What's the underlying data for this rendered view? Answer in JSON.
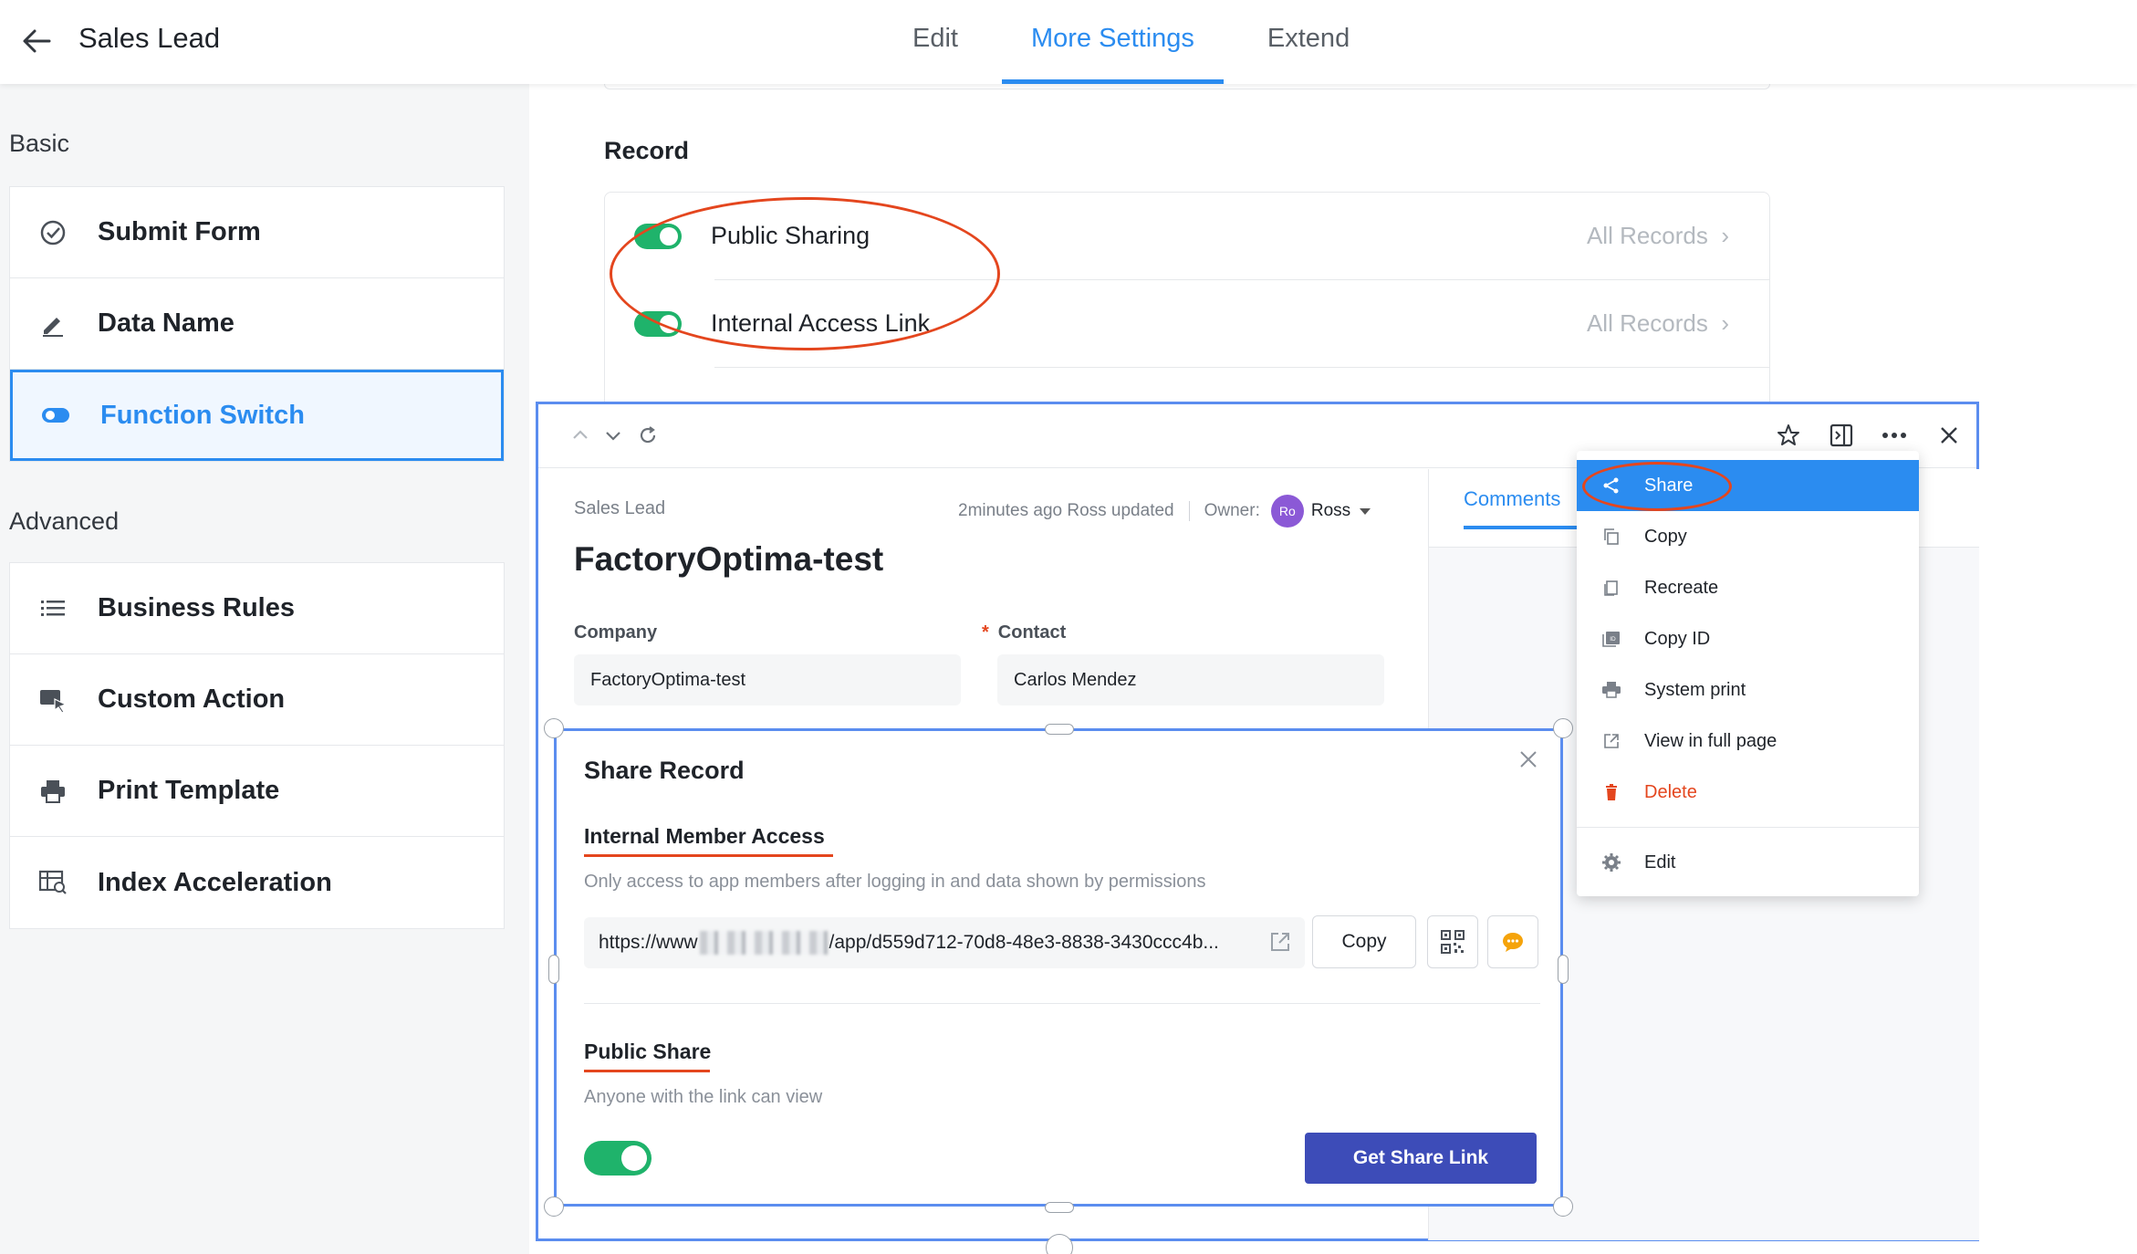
{
  "header": {
    "title": "Sales Lead",
    "tabs": [
      {
        "label": "Edit"
      },
      {
        "label": "More Settings",
        "active": true
      },
      {
        "label": "Extend"
      }
    ]
  },
  "sidebar": {
    "basic_label": "Basic",
    "basic_items": [
      {
        "label": "Submit Form",
        "icon": "check-circle-icon"
      },
      {
        "label": "Data Name",
        "icon": "pencil-icon"
      },
      {
        "label": "Function Switch",
        "icon": "toggle-icon",
        "selected": true
      }
    ],
    "advanced_label": "Advanced",
    "advanced_items": [
      {
        "label": "Business Rules",
        "icon": "list-icon"
      },
      {
        "label": "Custom Action",
        "icon": "cursor-card-icon"
      },
      {
        "label": "Print Template",
        "icon": "printer-icon"
      },
      {
        "label": "Index Acceleration",
        "icon": "table-search-icon"
      }
    ]
  },
  "record_section": {
    "title": "Record",
    "rows": [
      {
        "label": "Public Sharing",
        "link": "All Records",
        "enabled": true
      },
      {
        "label": "Internal Access Link",
        "link": "All Records",
        "enabled": true
      }
    ]
  },
  "detail": {
    "breadcrumb": "Sales Lead",
    "updated": "2minutes ago Ross updated",
    "owner_label": "Owner:",
    "owner_initials": "Ro",
    "owner_name": "Ross",
    "record_name": "FactoryOptima-test",
    "fields": [
      {
        "label": "Company",
        "value": "FactoryOptima-test",
        "required": false
      },
      {
        "label": "Contact",
        "value": "Carlos Mendez",
        "required": true
      }
    ],
    "right_tab": "Comments"
  },
  "more_menu": {
    "items": [
      {
        "label": "Share",
        "icon": "share-icon",
        "active": true
      },
      {
        "label": "Copy",
        "icon": "copy-icon"
      },
      {
        "label": "Recreate",
        "icon": "recreate-icon"
      },
      {
        "label": "Copy ID",
        "icon": "id-card-icon"
      },
      {
        "label": "System print",
        "icon": "printer-icon"
      },
      {
        "label": "View in full page",
        "icon": "external-link-icon"
      },
      {
        "label": "Delete",
        "icon": "trash-icon",
        "danger": true
      }
    ],
    "edit_label": "Edit"
  },
  "share_modal": {
    "title": "Share Record",
    "internal_title": "Internal Member Access",
    "internal_desc": "Only access to app members after logging in and data shown by permissions",
    "url_prefix": "https://www",
    "url_suffix": "/app/d559d712-70d8-48e3-8838-3430ccc4b...",
    "copy_label": "Copy",
    "public_title": "Public Share",
    "public_desc": "Anyone with the link can view",
    "public_enabled": true,
    "get_link_label": "Get Share Link"
  },
  "colors": {
    "accent": "#2b8cf0",
    "toggle_on": "#1fb36b",
    "annotation_red": "#e4461e",
    "primary_button": "#3d4cb8"
  }
}
